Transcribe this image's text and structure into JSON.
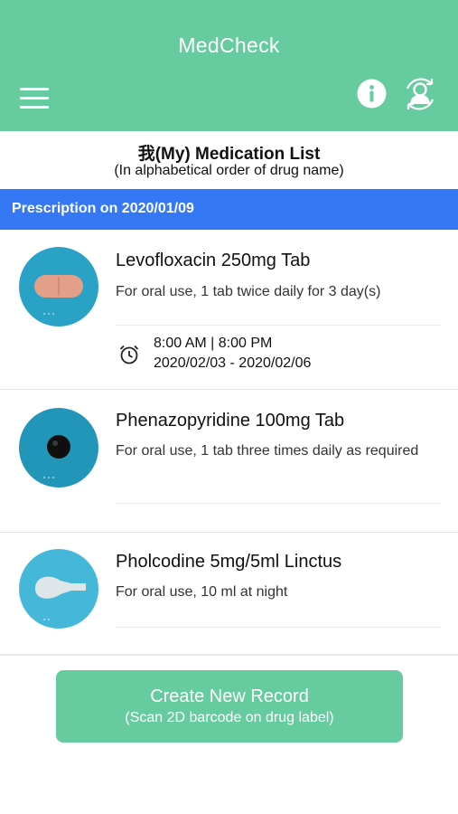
{
  "header": {
    "title": "MedCheck",
    "menu_icon": "hamburger-menu-icon",
    "info_icon": "info-icon",
    "account_icon": "account-sync-icon",
    "bg_color": "#66cca0"
  },
  "list": {
    "title": "我(My) Medication List",
    "subtitle": "(In alphabetical order of drug name)"
  },
  "prescription": {
    "label": "Prescription on 2020/01/09",
    "bg_color": "#3478f6"
  },
  "medications": [
    {
      "name": "Levofloxacin 250mg Tab",
      "instructions": "For oral use,  1 tab  twice daily for 3 day(s)",
      "image": "orange-tablet-image",
      "schedule": {
        "icon": "alarm-clock-icon",
        "times": "8:00 AM | 8:00 PM",
        "dates": "2020/02/03 - 2020/02/06"
      }
    },
    {
      "name": "Phenazopyridine 100mg Tab",
      "instructions": "For oral use,  1 tab  three times daily as required",
      "image": "black-round-tablet-image"
    },
    {
      "name": "Pholcodine 5mg/5ml Linctus",
      "instructions": "For oral use,  10 ml  at night",
      "image": "medicine-spoon-image"
    }
  ],
  "create_button": {
    "line1": "Create New Record",
    "line2": "(Scan 2D barcode on drug label)"
  }
}
